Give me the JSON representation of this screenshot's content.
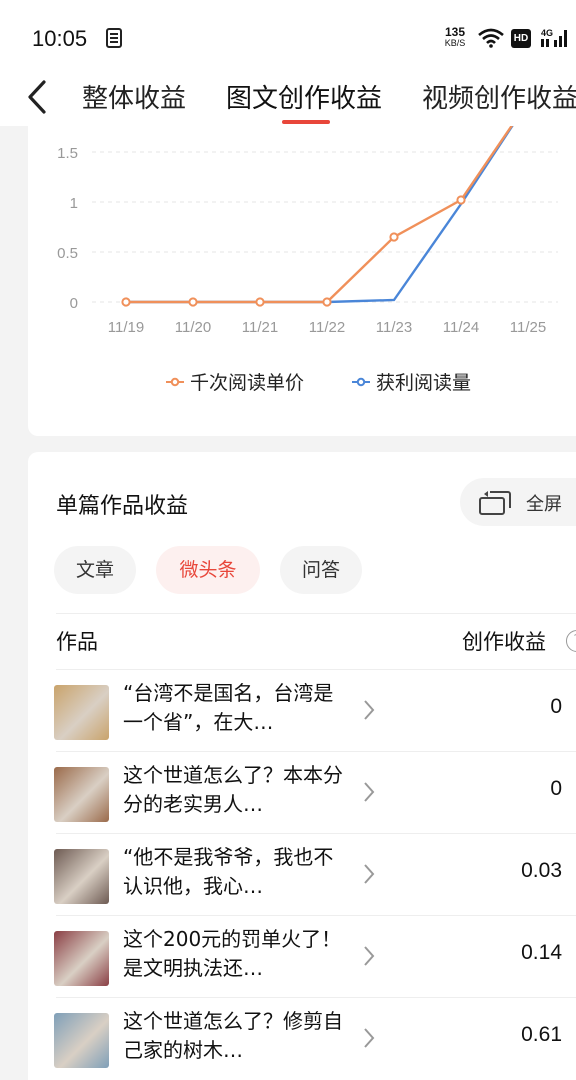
{
  "status_bar": {
    "time": "10:05",
    "net_speed_value": "135",
    "net_speed_unit": "KB/S",
    "hd": "HD",
    "network": "4G"
  },
  "nav": {
    "tabs": [
      {
        "label": "整体收益",
        "active": false
      },
      {
        "label": "图文创作收益",
        "active": true
      },
      {
        "label": "视频创作收益",
        "active": false
      }
    ],
    "accent_color": "#e8463a"
  },
  "chart_data": {
    "type": "line",
    "x": [
      "11/19",
      "11/20",
      "11/21",
      "11/22",
      "11/23",
      "11/24",
      "11/25"
    ],
    "y_ticks": [
      "0",
      "0.5",
      "1",
      "1.5"
    ],
    "ylim": [
      0,
      1.75
    ],
    "grid": true,
    "legend_position": "bottom",
    "series": [
      {
        "name": "千次阅读单价",
        "color": "#f0905a",
        "values": [
          0,
          0,
          0,
          0,
          0.65,
          1.02,
          2.0
        ],
        "markers": true
      },
      {
        "name": "获利阅读量",
        "color": "#4a86d8",
        "values": [
          0,
          0,
          0,
          0,
          0.02,
          0.98,
          2.0
        ],
        "markers": false
      }
    ]
  },
  "works": {
    "title": "单篇作品收益",
    "fullscreen_label": "全屏",
    "filters": [
      {
        "label": "文章",
        "active": false
      },
      {
        "label": "微头条",
        "active": true
      },
      {
        "label": "问答",
        "active": false
      }
    ],
    "col_work": "作品",
    "col_income": "创作收益",
    "rows": [
      {
        "title": "“台湾不是国名，台湾是一个省”，在大…",
        "value": "0",
        "thumb": "#c9a36b"
      },
      {
        "title": "这个世道怎么了？本本分分的老实男人…",
        "value": "0",
        "thumb": "#9a6a4a"
      },
      {
        "title": "“他不是我爷爷，我也不认识他，我心…",
        "value": "0.03",
        "thumb": "#6d5a52"
      },
      {
        "title": "这个200元的罚单火了！是文明执法还…",
        "value": "0.14",
        "thumb": "#8a3e44"
      },
      {
        "title": "这个世道怎么了？修剪自己家的树木…",
        "value": "0.61",
        "thumb": "#7f9fb8"
      }
    ]
  }
}
